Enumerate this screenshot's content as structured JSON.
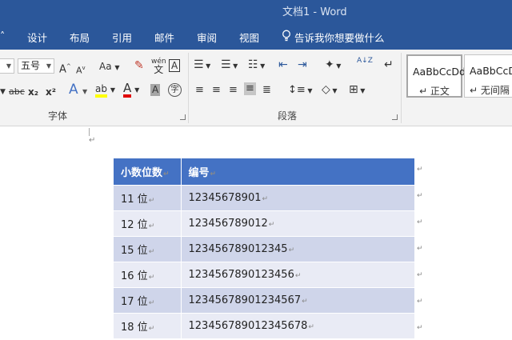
{
  "window": {
    "title": "文档1  -  Word"
  },
  "tabs": {
    "items": [
      "设计",
      "布局",
      "引用",
      "邮件",
      "审阅",
      "视图"
    ],
    "tell_me": "告诉我你想要做什么"
  },
  "ribbon": {
    "font_size": "五号",
    "grow_font": "A",
    "shrink_font": "A",
    "change_case": "Aa",
    "strikethrough": "abc",
    "subscript": "x₂",
    "superscript": "x²",
    "phonetic": "wén",
    "char_border": "A",
    "text_effects": "A",
    "char_shading": "A",
    "enclose": "字",
    "sort": "A↓Z",
    "font_group": "字体",
    "paragraph_group": "段落",
    "styles": [
      {
        "sample": "AaBbCcDd",
        "name": "↵ 正文"
      },
      {
        "sample": "AaBbCcDd",
        "name": "↵ 无间隔"
      }
    ]
  },
  "document": {
    "mark": "↵",
    "table": {
      "headers": [
        "小数位数",
        "编号"
      ],
      "rows": [
        [
          "11 位",
          "12345678901"
        ],
        [
          "12 位",
          "123456789012"
        ],
        [
          "15 位",
          "123456789012345"
        ],
        [
          "16 位",
          "1234567890123456"
        ],
        [
          "17 位",
          "12345678901234567"
        ],
        [
          "18 位",
          "123456789012345678"
        ]
      ]
    }
  },
  "colors": {
    "accent": "#2b579a",
    "table_header": "#4472c4",
    "band_dark": "#cfd5ea",
    "band_light": "#e9ebf5"
  }
}
